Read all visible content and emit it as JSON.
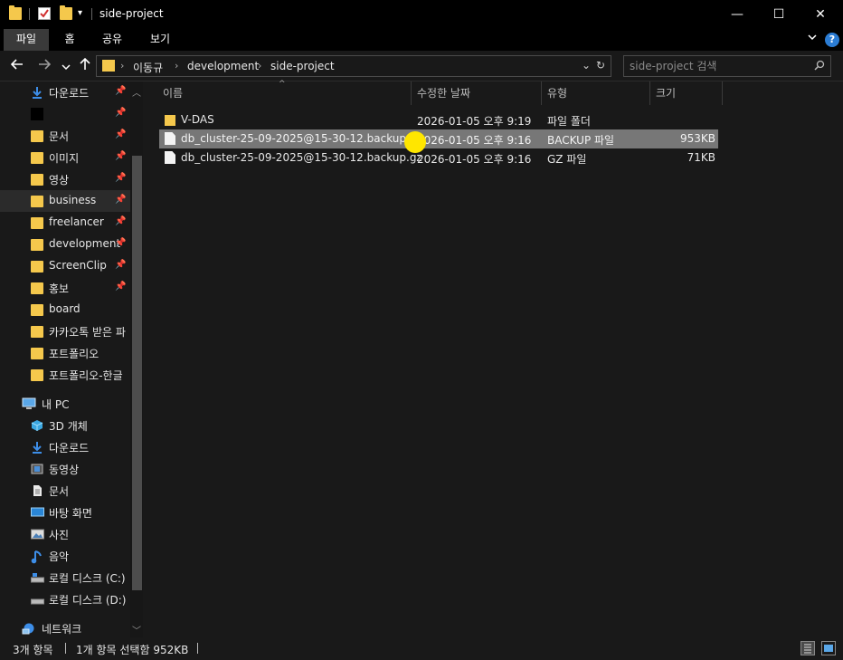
{
  "window": {
    "title": "side-project",
    "minimize_glyph": "—",
    "maximize_glyph": "☐",
    "close_glyph": "✕"
  },
  "ribbon": {
    "tabs": [
      {
        "label": "파일",
        "active": true
      },
      {
        "label": "홈",
        "active": false
      },
      {
        "label": "공유",
        "active": false
      },
      {
        "label": "보기",
        "active": false
      }
    ],
    "help_glyph": "?"
  },
  "address": {
    "breadcrumbs": [
      "이동규",
      "development",
      "side-project"
    ],
    "search_placeholder": "side-project 검색"
  },
  "nav_pane": {
    "quick_access": [
      {
        "label": "다운로드",
        "icon": "download-icon",
        "pinned": true
      },
      {
        "label": "",
        "icon": "black-square-icon",
        "pinned": true
      },
      {
        "label": "문서",
        "icon": "folder-icon",
        "pinned": true
      },
      {
        "label": "이미지",
        "icon": "folder-icon",
        "pinned": true
      },
      {
        "label": "영상",
        "icon": "folder-icon",
        "pinned": true
      },
      {
        "label": "business",
        "icon": "folder-icon",
        "pinned": true,
        "selected": true
      },
      {
        "label": "freelancer",
        "icon": "folder-icon",
        "pinned": true
      },
      {
        "label": "development",
        "icon": "folder-icon",
        "pinned": true
      },
      {
        "label": "ScreenClip",
        "icon": "folder-icon",
        "pinned": true
      },
      {
        "label": "홍보",
        "icon": "folder-icon",
        "pinned": true
      },
      {
        "label": "board",
        "icon": "folder-icon",
        "pinned": false
      },
      {
        "label": "카카오톡 받은 파",
        "icon": "folder-icon",
        "pinned": false
      },
      {
        "label": "포트폴리오",
        "icon": "folder-icon",
        "pinned": false
      },
      {
        "label": "포트폴리오-한글",
        "icon": "folder-icon",
        "pinned": false
      }
    ],
    "this_pc": {
      "label": "내 PC",
      "icon": "computer-icon"
    },
    "pc_items": [
      {
        "label": "3D 개체",
        "icon": "cube-3d-icon"
      },
      {
        "label": "다운로드",
        "icon": "download-icon"
      },
      {
        "label": "동영상",
        "icon": "video-icon"
      },
      {
        "label": "문서",
        "icon": "document-icon"
      },
      {
        "label": "바탕 화면",
        "icon": "desktop-icon"
      },
      {
        "label": "사진",
        "icon": "picture-icon"
      },
      {
        "label": "음악",
        "icon": "music-icon"
      },
      {
        "label": "로컬 디스크 (C:)",
        "icon": "drive-c-icon"
      },
      {
        "label": "로컬 디스크 (D:)",
        "icon": "drive-d-icon"
      }
    ],
    "network": {
      "label": "네트워크",
      "icon": "network-icon"
    }
  },
  "file_list": {
    "columns": [
      "이름",
      "수정한 날짜",
      "유형",
      "크기"
    ],
    "rows": [
      {
        "name": "V-DAS",
        "modified": "2026-01-05 오후 9:19",
        "type": "파일 폴더",
        "size": "",
        "icon": "folder-icon",
        "selected": false
      },
      {
        "name": "db_cluster-25-09-2025@15-30-12.backup",
        "modified": "2026-01-05 오후 9:16",
        "type": "BACKUP 파일",
        "size": "953KB",
        "icon": "file-icon",
        "selected": true
      },
      {
        "name": "db_cluster-25-09-2025@15-30-12.backup.gz",
        "modified": "2026-01-05 오후 9:16",
        "type": "GZ 파일",
        "size": "71KB",
        "icon": "file-icon",
        "selected": false
      }
    ]
  },
  "status": {
    "item_count": "3개 항목",
    "selection": "1개 항목 선택함 952KB"
  },
  "colors": {
    "accent": "#2b7cd3",
    "folder": "#f5c84c",
    "cursor_highlight": "#ffe600"
  }
}
